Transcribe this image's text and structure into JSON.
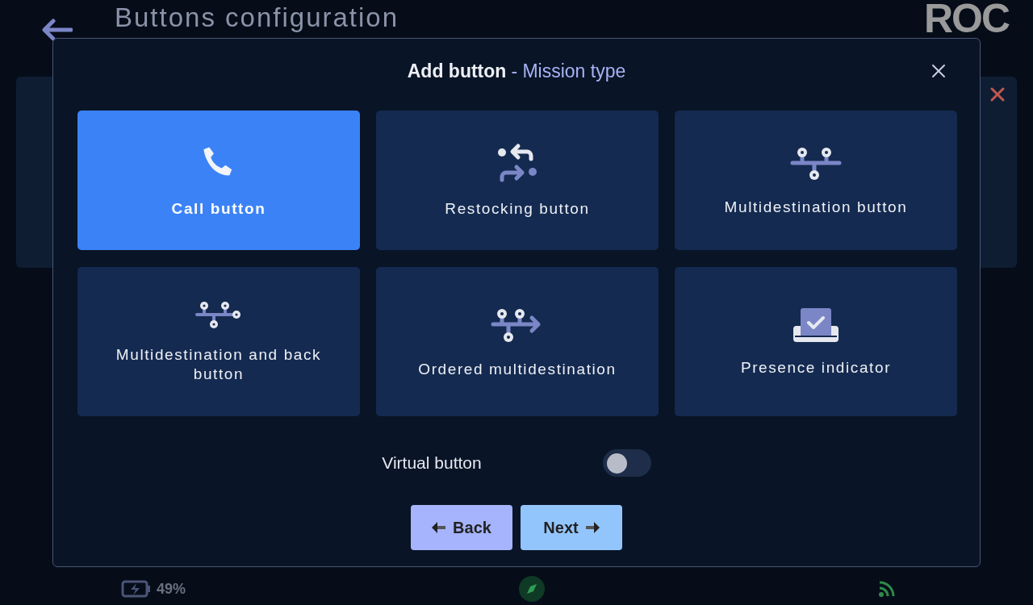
{
  "page": {
    "title": "Buttons configuration",
    "logo": "ROC"
  },
  "modal": {
    "title": "Add button",
    "subtitle": "- Mission type",
    "options": [
      {
        "label": "Call button",
        "kind": "call",
        "selected": true
      },
      {
        "label": "Restocking button",
        "kind": "restock",
        "selected": false
      },
      {
        "label": "Multidestination button",
        "kind": "multi",
        "selected": false
      },
      {
        "label": "Multidestination and back button",
        "kind": "multiback",
        "selected": false
      },
      {
        "label": "Ordered multidestination",
        "kind": "ordered",
        "selected": false
      },
      {
        "label": "Presence indicator",
        "kind": "presence",
        "selected": false
      }
    ],
    "virtual_toggle": {
      "label": "Virtual button",
      "on": false
    },
    "buttons": [
      {
        "label": "Back",
        "kind": "back"
      },
      {
        "label": "Next",
        "kind": "next"
      }
    ]
  },
  "status_bar": {
    "battery": "49%"
  }
}
